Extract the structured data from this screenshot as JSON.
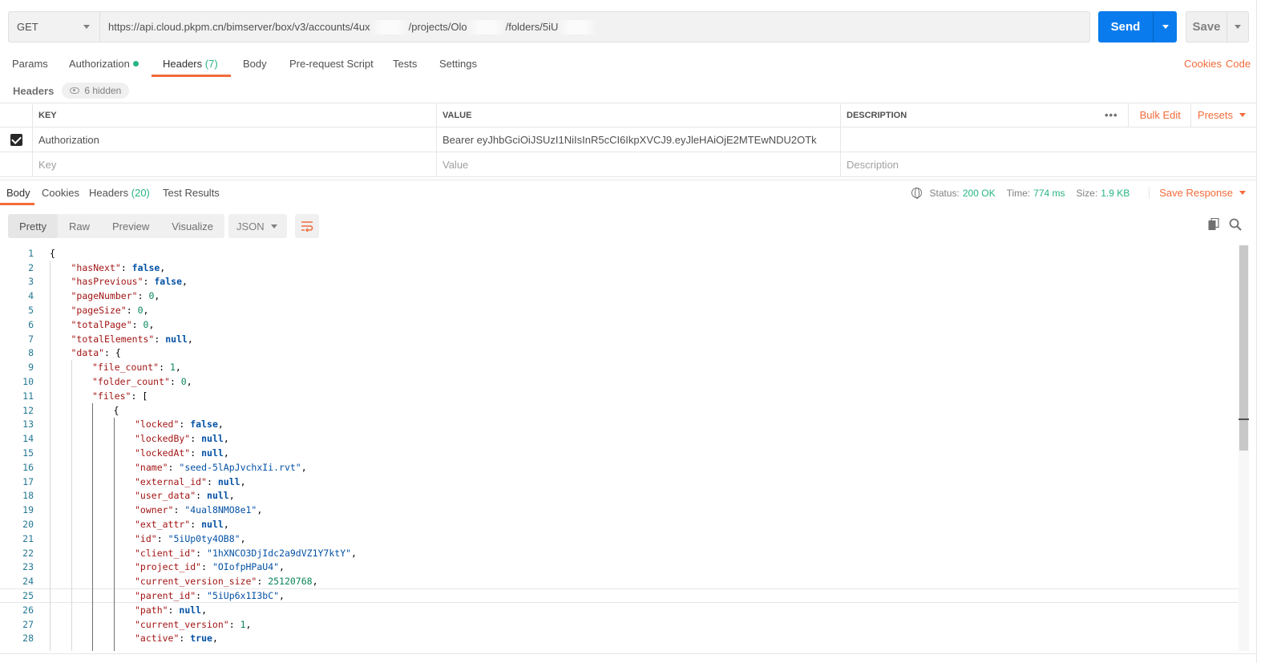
{
  "request": {
    "method": "GET",
    "url_parts": [
      "https://api.cloud.pkpm.cn/bimserver/box/v3/accounts/4ux",
      "/projects/Olo",
      "/folders/5iU"
    ],
    "send_label": "Send",
    "save_label": "Save"
  },
  "tabs": [
    {
      "label": "Params"
    },
    {
      "label": "Authorization"
    },
    {
      "label": "Headers",
      "count": "(7)"
    },
    {
      "label": "Body"
    },
    {
      "label": "Pre-request Script"
    },
    {
      "label": "Tests"
    },
    {
      "label": "Settings"
    }
  ],
  "tab_links": {
    "cookies": "Cookies",
    "code": "Code"
  },
  "headers_section": {
    "label": "Headers",
    "hidden": "6 hidden"
  },
  "headers_table": {
    "columns": [
      "KEY",
      "VALUE",
      "DESCRIPTION"
    ],
    "actions": {
      "bulk_edit": "Bulk Edit",
      "presets": "Presets",
      "more": "•••"
    },
    "rows": [
      {
        "checked": true,
        "key": "Authorization",
        "value": "Bearer eyJhbGciOiJSUzI1NiIsInR5cCI6IkpXVCJ9.eyJleHAiOjE2MTEwNDU2OTk",
        "description": ""
      }
    ],
    "placeholders": {
      "key": "Key",
      "value": "Value",
      "description": "Description"
    }
  },
  "response": {
    "tabs": [
      {
        "label": "Body"
      },
      {
        "label": "Cookies"
      },
      {
        "label": "Headers",
        "count": "(20)"
      },
      {
        "label": "Test Results"
      }
    ],
    "status_label": "Status:",
    "status": "200 OK",
    "time_label": "Time:",
    "time": "774 ms",
    "size_label": "Size:",
    "size": "1.9 KB",
    "save_response": "Save Response",
    "view_modes": [
      "Pretty",
      "Raw",
      "Preview",
      "Visualize"
    ],
    "format": "JSON"
  },
  "colors": {
    "accent": "#f26b3a",
    "send": "#097bed",
    "success": "#26b47f"
  },
  "icons": {
    "send_dropdown": "caret-down-icon",
    "wrap": "wrap-lines-icon",
    "copy": "copy-icon",
    "search": "search-icon",
    "globe": "globe-icon",
    "eye": "eye-icon"
  },
  "code_lines": [
    {
      "n": "1",
      "indent": 0,
      "tokens": [
        [
          "p",
          "{"
        ]
      ]
    },
    {
      "n": "2",
      "indent": 1,
      "tokens": [
        [
          "k",
          "\"hasNext\""
        ],
        [
          "p",
          ": "
        ],
        [
          "b",
          "false"
        ],
        [
          "p",
          ","
        ]
      ]
    },
    {
      "n": "3",
      "indent": 1,
      "tokens": [
        [
          "k",
          "\"hasPrevious\""
        ],
        [
          "p",
          ": "
        ],
        [
          "b",
          "false"
        ],
        [
          "p",
          ","
        ]
      ]
    },
    {
      "n": "4",
      "indent": 1,
      "tokens": [
        [
          "k",
          "\"pageNumber\""
        ],
        [
          "p",
          ": "
        ],
        [
          "n",
          "0"
        ],
        [
          "p",
          ","
        ]
      ]
    },
    {
      "n": "5",
      "indent": 1,
      "tokens": [
        [
          "k",
          "\"pageSize\""
        ],
        [
          "p",
          ": "
        ],
        [
          "n",
          "0"
        ],
        [
          "p",
          ","
        ]
      ]
    },
    {
      "n": "6",
      "indent": 1,
      "tokens": [
        [
          "k",
          "\"totalPage\""
        ],
        [
          "p",
          ": "
        ],
        [
          "n",
          "0"
        ],
        [
          "p",
          ","
        ]
      ]
    },
    {
      "n": "7",
      "indent": 1,
      "tokens": [
        [
          "k",
          "\"totalElements\""
        ],
        [
          "p",
          ": "
        ],
        [
          "b",
          "null"
        ],
        [
          "p",
          ","
        ]
      ]
    },
    {
      "n": "8",
      "indent": 1,
      "tokens": [
        [
          "k",
          "\"data\""
        ],
        [
          "p",
          ": {"
        ]
      ]
    },
    {
      "n": "9",
      "indent": 2,
      "tokens": [
        [
          "k",
          "\"file_count\""
        ],
        [
          "p",
          ": "
        ],
        [
          "n",
          "1"
        ],
        [
          "p",
          ","
        ]
      ]
    },
    {
      "n": "10",
      "indent": 2,
      "tokens": [
        [
          "k",
          "\"folder_count\""
        ],
        [
          "p",
          ": "
        ],
        [
          "n",
          "0"
        ],
        [
          "p",
          ","
        ]
      ]
    },
    {
      "n": "11",
      "indent": 2,
      "tokens": [
        [
          "k",
          "\"files\""
        ],
        [
          "p",
          ": ["
        ]
      ]
    },
    {
      "n": "12",
      "indent": 3,
      "tokens": [
        [
          "p",
          "{"
        ]
      ]
    },
    {
      "n": "13",
      "indent": 4,
      "tokens": [
        [
          "k",
          "\"locked\""
        ],
        [
          "p",
          ": "
        ],
        [
          "b",
          "false"
        ],
        [
          "p",
          ","
        ]
      ]
    },
    {
      "n": "14",
      "indent": 4,
      "tokens": [
        [
          "k",
          "\"lockedBy\""
        ],
        [
          "p",
          ": "
        ],
        [
          "b",
          "null"
        ],
        [
          "p",
          ","
        ]
      ]
    },
    {
      "n": "15",
      "indent": 4,
      "tokens": [
        [
          "k",
          "\"lockedAt\""
        ],
        [
          "p",
          ": "
        ],
        [
          "b",
          "null"
        ],
        [
          "p",
          ","
        ]
      ]
    },
    {
      "n": "16",
      "indent": 4,
      "tokens": [
        [
          "k",
          "\"name\""
        ],
        [
          "p",
          ": "
        ],
        [
          "s",
          "\"seed-5lApJvchxIi.rvt\""
        ],
        [
          "p",
          ","
        ]
      ]
    },
    {
      "n": "17",
      "indent": 4,
      "tokens": [
        [
          "k",
          "\"external_id\""
        ],
        [
          "p",
          ": "
        ],
        [
          "b",
          "null"
        ],
        [
          "p",
          ","
        ]
      ]
    },
    {
      "n": "18",
      "indent": 4,
      "tokens": [
        [
          "k",
          "\"user_data\""
        ],
        [
          "p",
          ": "
        ],
        [
          "b",
          "null"
        ],
        [
          "p",
          ","
        ]
      ]
    },
    {
      "n": "19",
      "indent": 4,
      "tokens": [
        [
          "k",
          "\"owner\""
        ],
        [
          "p",
          ": "
        ],
        [
          "s",
          "\"4ual8NMO8e1\""
        ],
        [
          "p",
          ","
        ]
      ]
    },
    {
      "n": "20",
      "indent": 4,
      "tokens": [
        [
          "k",
          "\"ext_attr\""
        ],
        [
          "p",
          ": "
        ],
        [
          "b",
          "null"
        ],
        [
          "p",
          ","
        ]
      ]
    },
    {
      "n": "21",
      "indent": 4,
      "tokens": [
        [
          "k",
          "\"id\""
        ],
        [
          "p",
          ": "
        ],
        [
          "s",
          "\"5iUp0ty4OB8\""
        ],
        [
          "p",
          ","
        ]
      ]
    },
    {
      "n": "22",
      "indent": 4,
      "tokens": [
        [
          "k",
          "\"client_id\""
        ],
        [
          "p",
          ": "
        ],
        [
          "s",
          "\"1hXNCO3DjIdc2a9dVZ1Y7ktY\""
        ],
        [
          "p",
          ","
        ]
      ]
    },
    {
      "n": "23",
      "indent": 4,
      "tokens": [
        [
          "k",
          "\"project_id\""
        ],
        [
          "p",
          ": "
        ],
        [
          "s",
          "\"OIofpHPaU4\""
        ],
        [
          "p",
          ","
        ]
      ]
    },
    {
      "n": "24",
      "indent": 4,
      "tokens": [
        [
          "k",
          "\"current_version_size\""
        ],
        [
          "p",
          ": "
        ],
        [
          "n",
          "25120768"
        ],
        [
          "p",
          ","
        ]
      ]
    },
    {
      "n": "25",
      "indent": 4,
      "tokens": [
        [
          "k",
          "\"parent_id\""
        ],
        [
          "p",
          ": "
        ],
        [
          "s",
          "\"5iUp6x1I3bC\""
        ],
        [
          "p",
          ","
        ]
      ]
    },
    {
      "n": "26",
      "indent": 4,
      "tokens": [
        [
          "k",
          "\"path\""
        ],
        [
          "p",
          ": "
        ],
        [
          "b",
          "null"
        ],
        [
          "p",
          ","
        ]
      ]
    },
    {
      "n": "27",
      "indent": 4,
      "tokens": [
        [
          "k",
          "\"current_version\""
        ],
        [
          "p",
          ": "
        ],
        [
          "n",
          "1"
        ],
        [
          "p",
          ","
        ]
      ]
    },
    {
      "n": "28",
      "indent": 4,
      "tokens": [
        [
          "k",
          "\"active\""
        ],
        [
          "p",
          ": "
        ],
        [
          "b",
          "true"
        ],
        [
          "p",
          ","
        ]
      ]
    }
  ],
  "editor": {
    "highlighted_line": "25"
  }
}
